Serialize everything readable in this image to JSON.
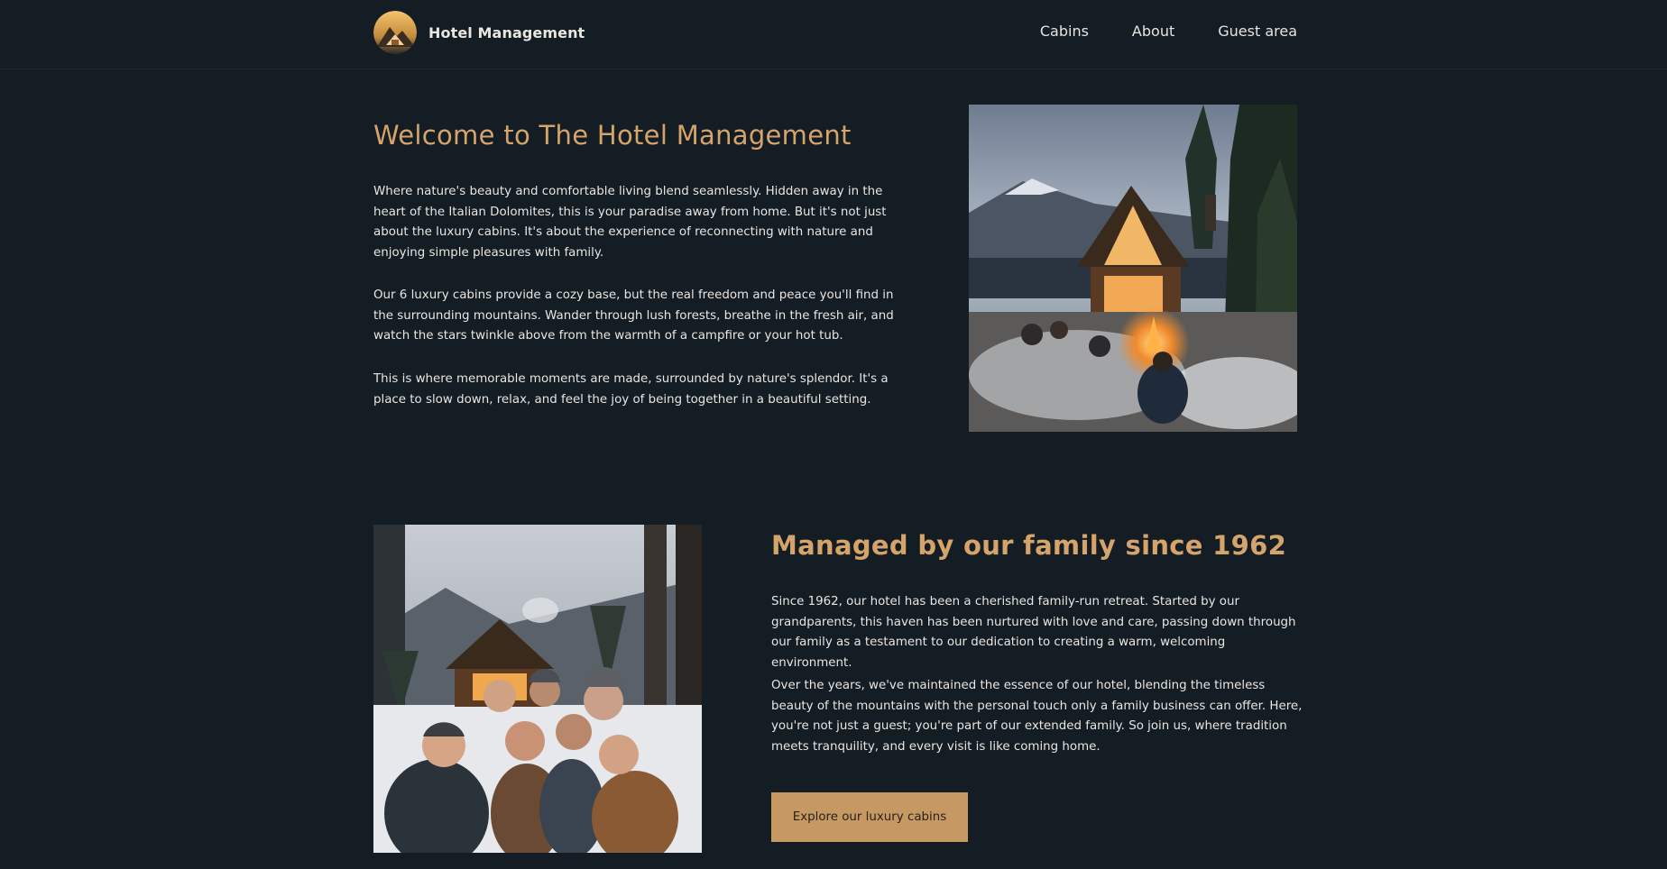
{
  "header": {
    "brand": "Hotel Management",
    "nav": [
      {
        "label": "Cabins"
      },
      {
        "label": "About"
      },
      {
        "label": "Guest area"
      }
    ]
  },
  "welcome": {
    "title": "Welcome to The Hotel Management",
    "paragraphs": [
      "Where nature's beauty and comfortable living blend seamlessly. Hidden away in the heart of the Italian Dolomites, this is your paradise away from home. But it's not just about the luxury cabins. It's about the experience of reconnecting with nature and enjoying simple pleasures with family.",
      "Our 6 luxury cabins provide a cozy base, but the real freedom and peace you'll find in the surrounding mountains. Wander through lush forests, breathe in the fresh air, and watch the stars twinkle above from the warmth of a campfire or your hot tub.",
      "This is where memorable moments are made, surrounded by nature's splendor. It's a place to slow down, relax, and feel the joy of being together in a beautiful setting."
    ]
  },
  "family": {
    "title": "Managed by our family since 1962",
    "paragraphs": [
      "Since 1962, our hotel has been a cherished family-run retreat. Started by our grandparents, this haven has been nurtured with love and care, passing down through our family as a testament to our dedication to creating a warm, welcoming environment.",
      "Over the years, we've maintained the essence of our hotel, blending the timeless beauty of the mountains with the personal touch only a family business can offer. Here, you're not just a guest; you're part of our extended family. So join us, where tradition meets tranquility, and every visit is like coming home."
    ],
    "cta_label": "Explore our luxury cabins"
  },
  "colors": {
    "background": "#141c24",
    "accent": "#d5a46b",
    "button": "#c69963"
  }
}
